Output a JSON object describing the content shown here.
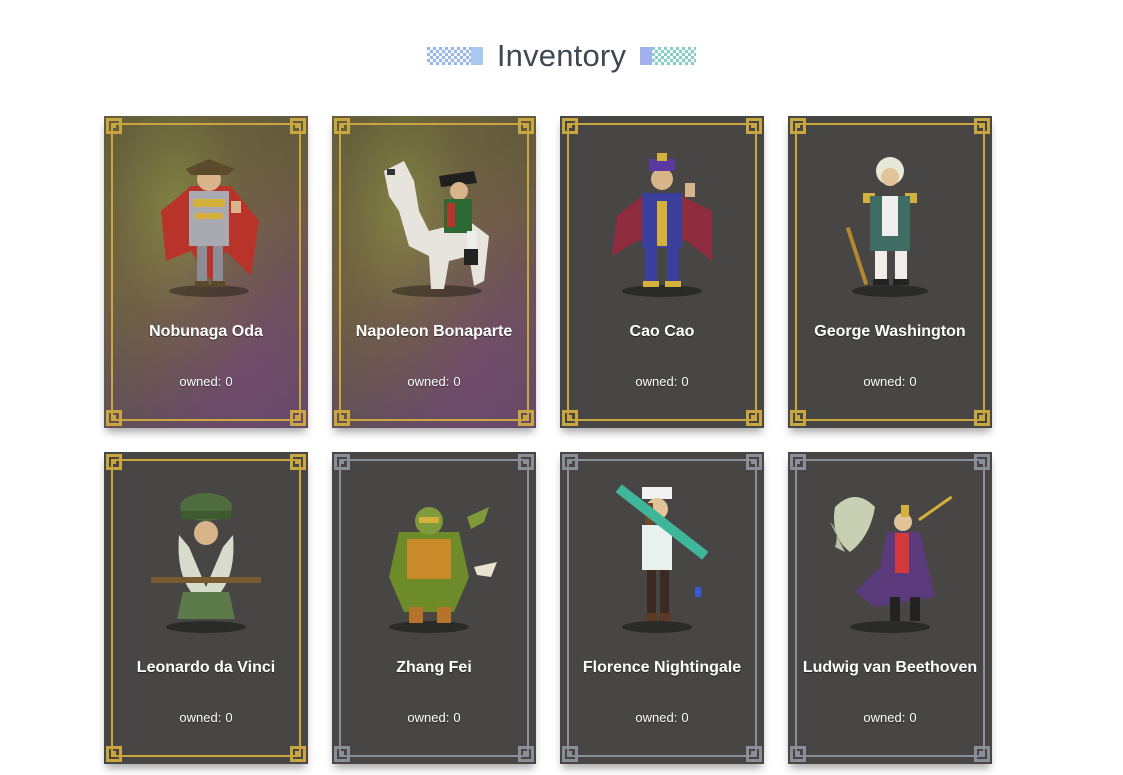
{
  "header": {
    "title": "Inventory"
  },
  "owned_label": "owned:",
  "cards": [
    {
      "name": "Nobunaga Oda",
      "owned": "0",
      "rarity": "legend",
      "frame": "gold",
      "accent": "#b8342a"
    },
    {
      "name": "Napoleon Bonaparte",
      "owned": "0",
      "rarity": "legend",
      "frame": "gold",
      "accent": "#2d6a33"
    },
    {
      "name": "Cao Cao",
      "owned": "0",
      "rarity": "epic",
      "frame": "gold",
      "accent": "#3b3f9c"
    },
    {
      "name": "George Washington",
      "owned": "0",
      "rarity": "epic",
      "frame": "gold",
      "accent": "#3f6d63"
    },
    {
      "name": "Leonardo da Vinci",
      "owned": "0",
      "rarity": "epic",
      "frame": "gold",
      "accent": "#5c7a4a"
    },
    {
      "name": "Zhang Fei",
      "owned": "0",
      "rarity": "rare",
      "frame": "silver",
      "accent": "#6e8b2a"
    },
    {
      "name": "Florence Nightingale",
      "owned": "0",
      "rarity": "rare",
      "frame": "silver",
      "accent": "#3fb59a"
    },
    {
      "name": "Ludwig van Beethoven",
      "owned": "0",
      "rarity": "rare",
      "frame": "silver",
      "accent": "#5a3a7a"
    }
  ],
  "colors": {
    "gold_frame": "#c9a640",
    "silver_frame": "#8a8e99",
    "card_background": "#474644"
  }
}
